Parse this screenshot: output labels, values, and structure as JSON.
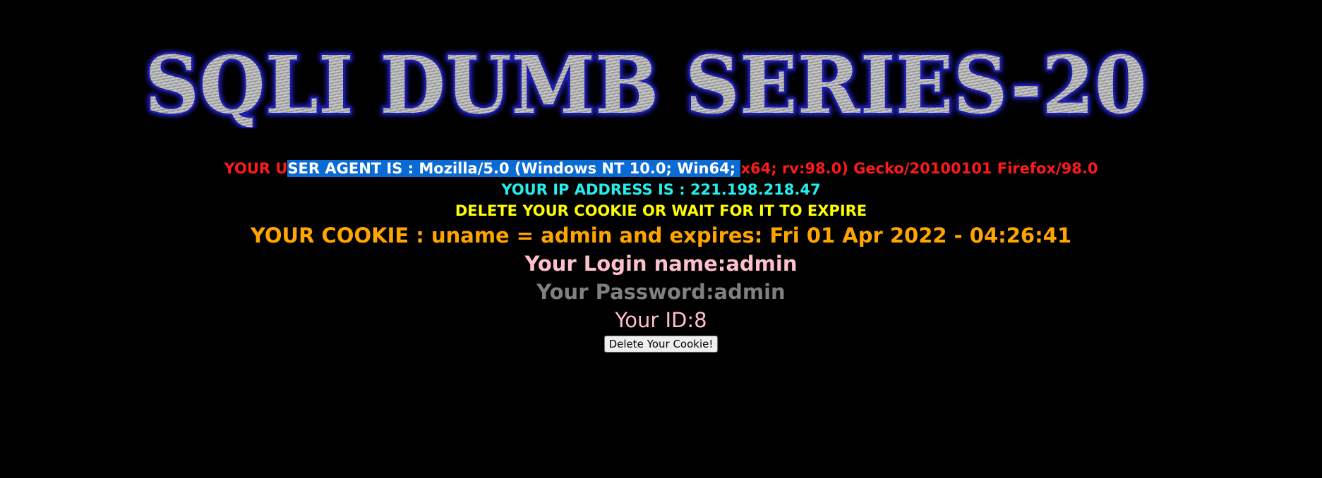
{
  "banner": {
    "title": "SQLI DUMB SERIES-20"
  },
  "info": {
    "user_agent_prefix_red": "YOUR U",
    "user_agent_selected": "SER AGENT IS : Mozilla/5.0 (Windows NT 10.0; Win64; ",
    "user_agent_suffix_red": "x64; rv:98.0) Gecko/20100101 Firefox/98.0",
    "ip_line": "YOUR IP ADDRESS IS : 221.198.218.47",
    "delete_notice": "DELETE YOUR COOKIE OR WAIT FOR IT TO EXPIRE",
    "cookie_line": "YOUR COOKIE : uname = admin and expires: Fri 01 Apr 2022 - 04:26:41",
    "login_line": "Your Login name:admin",
    "password_line": "Your Password:admin",
    "id_line": "Your ID:8"
  },
  "actions": {
    "delete_cookie_label": "Delete Your Cookie!"
  },
  "colors": {
    "background": "#000000",
    "user_agent": "#ff1a1a",
    "selection": "#0a6bd4",
    "ip": "#22f0ee",
    "delete_notice": "#ffff00",
    "cookie": "#ffa500",
    "login": "#ffc0cb",
    "password": "#808080",
    "id": "#ffc0cb"
  }
}
